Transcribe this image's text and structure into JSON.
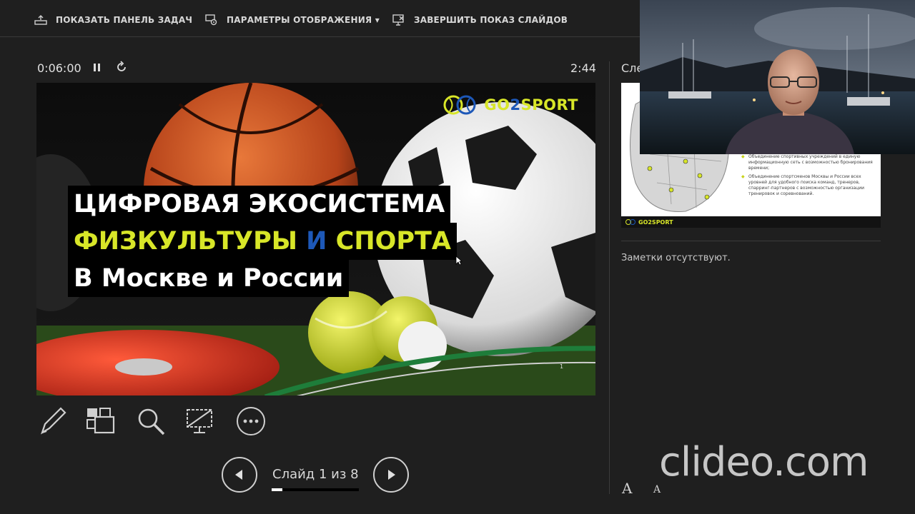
{
  "toolbar": {
    "show_taskbar": "ПОКАЗАТЬ ПАНЕЛЬ ЗАДАЧ",
    "display_settings": "ПАРАМЕТРЫ ОТОБРАЖЕНИЯ ▾",
    "end_show": "ЗАВЕРШИТЬ ПОКАЗ СЛАЙДОВ"
  },
  "timer": {
    "elapsed": "0:06:00",
    "clock": "2:44"
  },
  "current_slide": {
    "logo": {
      "prefix": "GO",
      "two": "2",
      "suffix": "SPORT"
    },
    "title_line1": "ЦИФРОВАЯ ЭКОСИСТЕМА",
    "title_line2_a": "ФИЗКУЛЬТУРЫ ",
    "title_line2_b": "И",
    "title_line2_c": " СПОРТА",
    "title_line3": "В Москве и России",
    "number": "1"
  },
  "navigation": {
    "counter": "Слайд 1 из 8",
    "progress": 0.125
  },
  "next_panel": {
    "label": "Сле",
    "bullets": [
      "Объединение спортивных учреждений в единую информационную сеть с возможностью бронирования времени;",
      "Объединение спортсменов Москвы и России всех уровней для удобного поиска команд, тренеров, спарринг-партнеров с возможностью организации тренировок и соревнований."
    ],
    "footer_logo": "GO2SPORT",
    "notes": "Заметки отсутствуют.",
    "font_up": "A",
    "font_down": "A"
  },
  "watermark": "clideo.com",
  "colors": {
    "accent_yellow": "#d8e628",
    "accent_blue": "#1d58b8",
    "background": "#1f1f1f"
  },
  "icons": [
    "taskbar-icon",
    "display-settings-icon",
    "end-show-icon",
    "pause-icon",
    "restart-icon",
    "pen-icon",
    "all-slides-icon",
    "zoom-icon",
    "black-screen-icon",
    "more-options-icon",
    "prev-icon",
    "next-icon"
  ]
}
